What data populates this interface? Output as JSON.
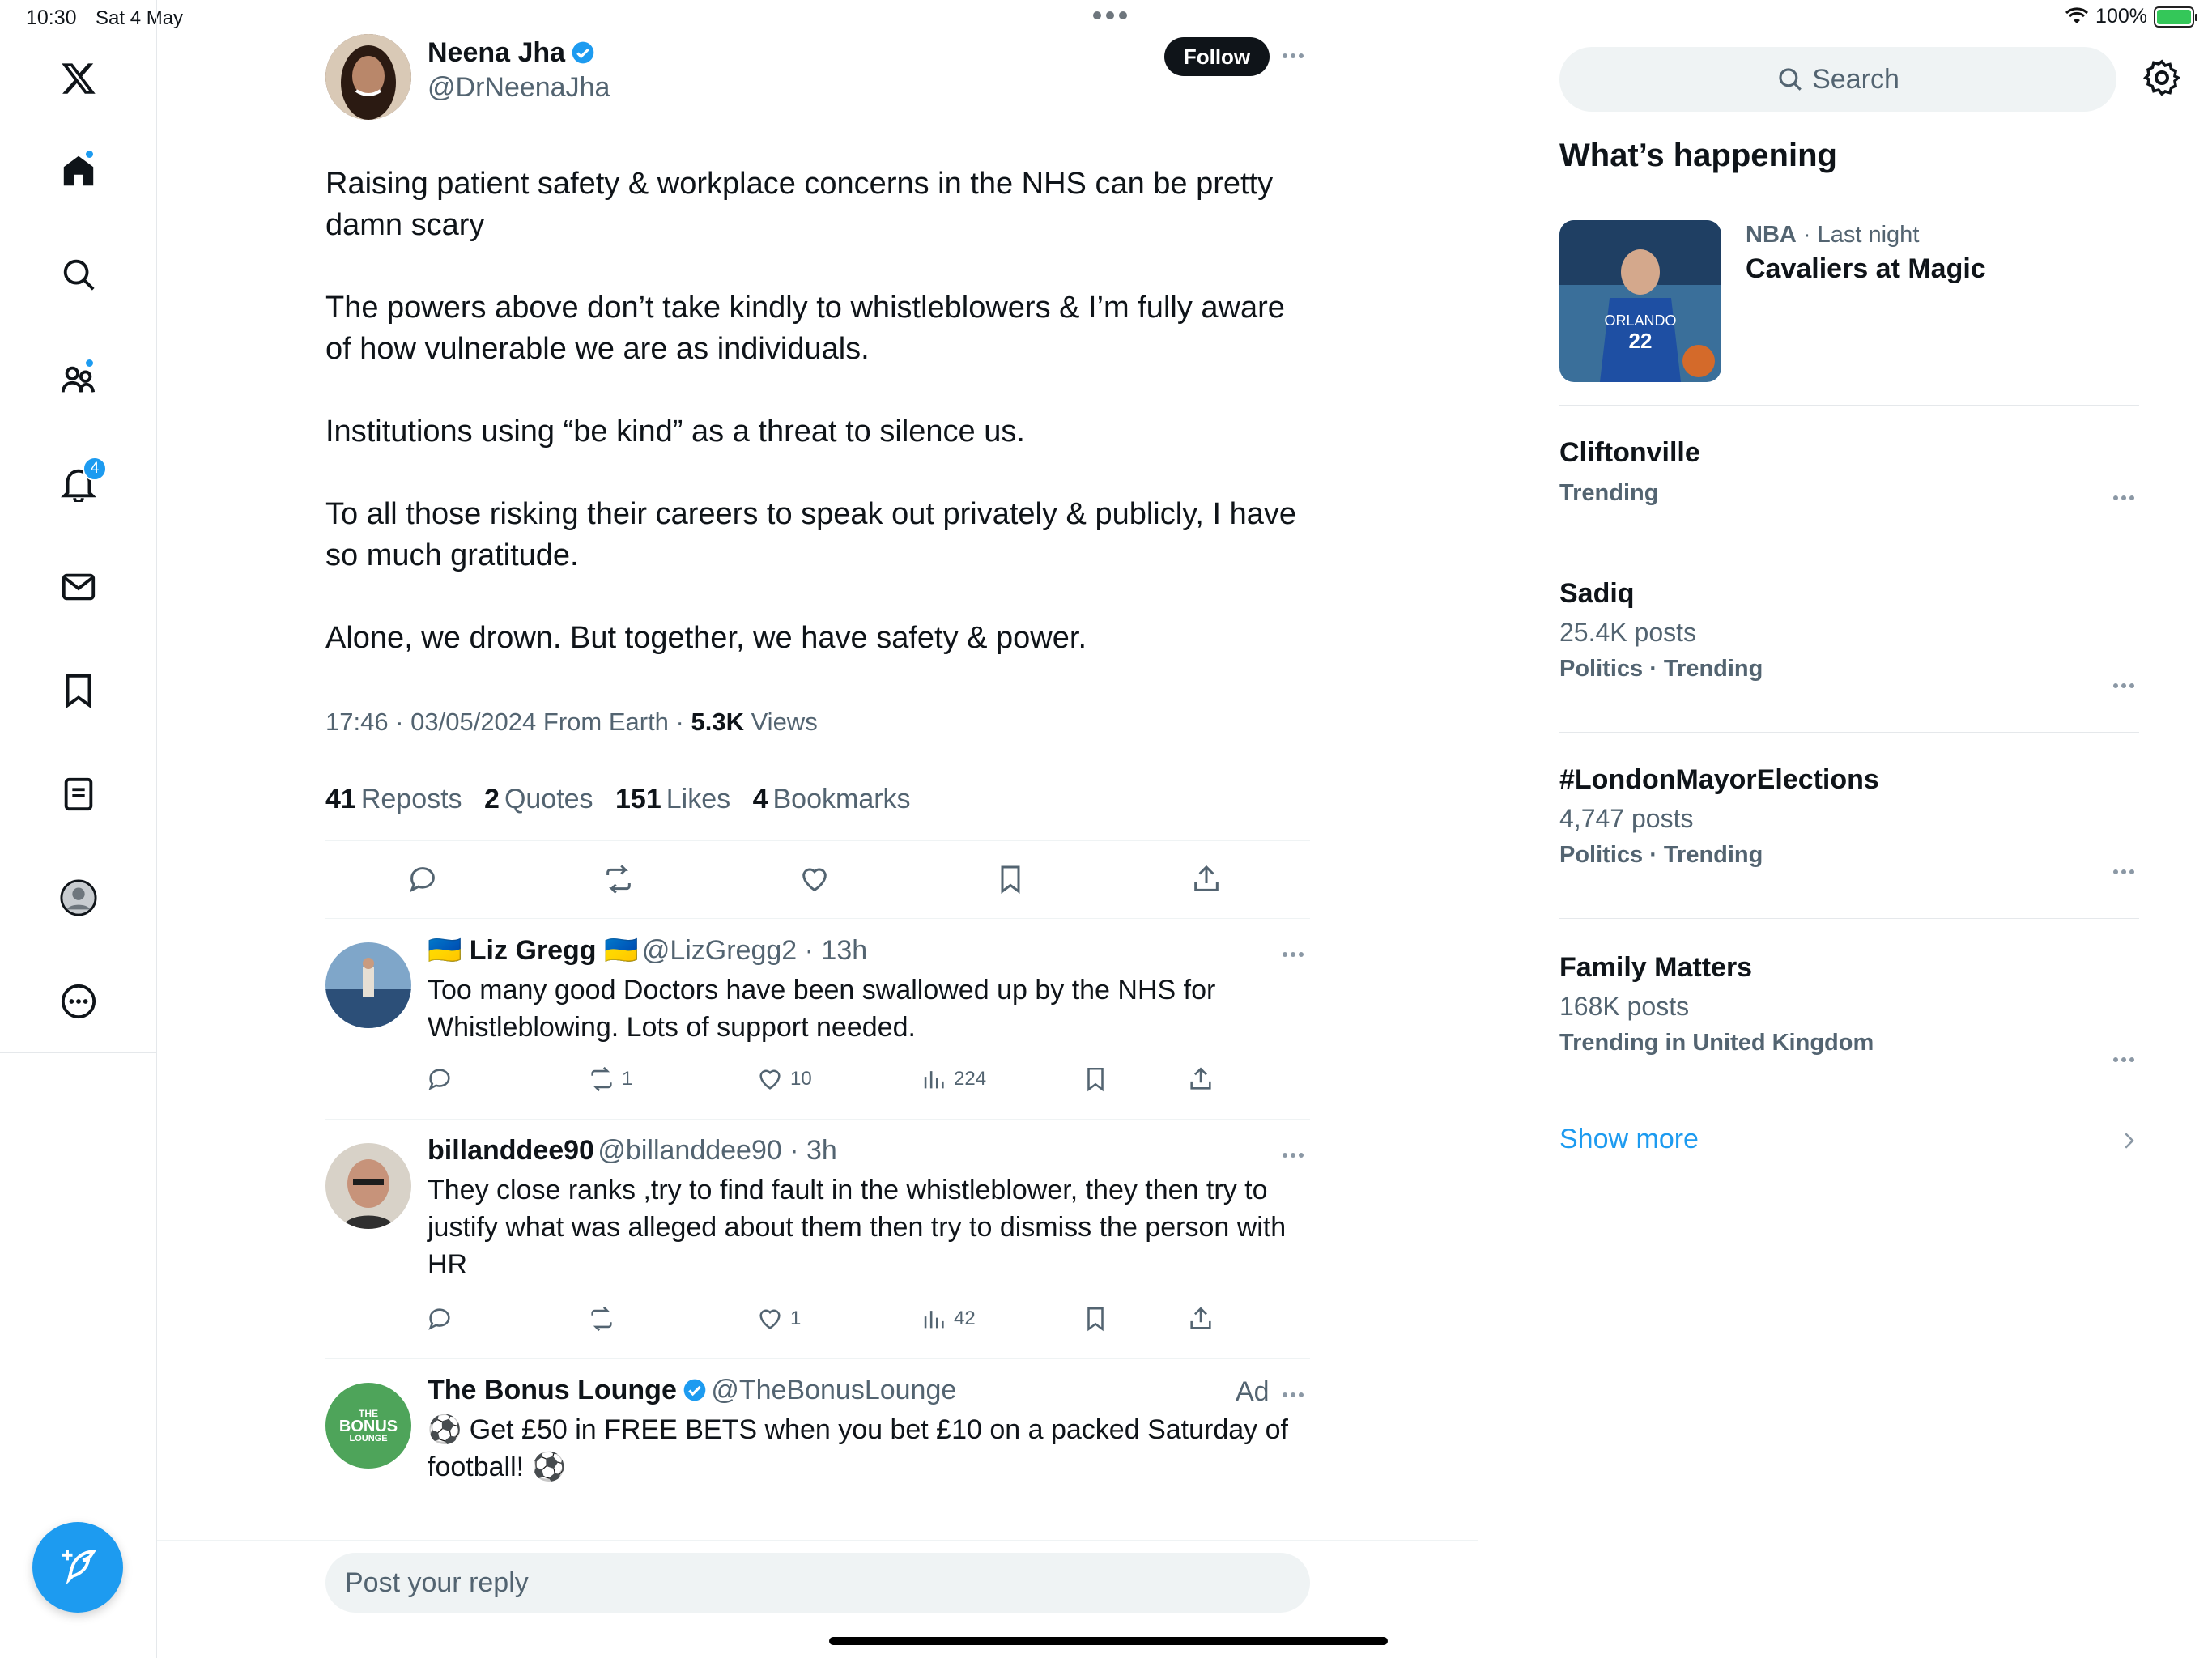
{
  "status_bar": {
    "time": "10:30",
    "date": "Sat 4 May",
    "battery": "100%"
  },
  "nav": {
    "notification_badge": "4"
  },
  "tweet": {
    "author_name": "Neena Jha",
    "author_handle": "@DrNeenaJha",
    "follow_label": "Follow",
    "paragraphs": [
      "Raising patient safety & workplace concerns in the NHS can be pretty damn scary",
      "The powers above don’t take kindly to whistleblowers & I’m fully aware of how vulnerable we are as individuals.",
      "Institutions using “be kind” as a threat to silence us.",
      "To all those risking their careers to speak out privately & publicly, I have so much gratitude.",
      "Alone, we drown. But together, we have safety & power."
    ],
    "meta": "17:46 · 03/05/2024 From Earth · ",
    "views_count": "5.3K",
    "views_label": " Views",
    "stats": {
      "reposts_count": "41",
      "reposts_label": "Reposts",
      "quotes_count": "2",
      "quotes_label": "Quotes",
      "likes_count": "151",
      "likes_label": "Likes",
      "bookmarks_count": "4",
      "bookmarks_label": "Bookmarks"
    }
  },
  "replies": [
    {
      "name": "🇺🇦 Liz Gregg 🇺🇦",
      "handle_time": "@LizGregg2 · 13h",
      "text": "Too many good Doctors have been swallowed up by the NHS for Whistleblowing.  Lots of support needed.",
      "reposts": "1",
      "likes": "10",
      "views": "224"
    },
    {
      "name": "billanddee90",
      "handle_time": "@billanddee90 · 3h",
      "text": "They close ranks ,try to find fault in the whistleblower, they then try to justify what was alleged about them then try to dismiss the person with HR",
      "reposts": "",
      "likes": "1",
      "views": "42"
    }
  ],
  "ad": {
    "name": "The Bonus Lounge",
    "handle": "@TheBonusLounge",
    "ad_label": "Ad",
    "text": "⚽ Get £50 in FREE BETS when you bet £10 on a packed Saturday of football! ⚽",
    "logo_text": [
      "THE",
      "BONUS",
      "LOUNGE"
    ]
  },
  "reply_box": {
    "placeholder": "Post your reply"
  },
  "sidebar": {
    "search_placeholder": "Search",
    "title": "What’s happening",
    "featured": {
      "category": "NBA",
      "time": " · Last night",
      "title": "Cavaliers at Magic",
      "jersey_text": "ORLANDO",
      "jersey_number": "22"
    },
    "trends": [
      {
        "title": "Cliftonville",
        "posts": "",
        "sub": "Trending"
      },
      {
        "title": "Sadiq",
        "posts": "25.4K posts",
        "sub": "Politics · Trending"
      },
      {
        "title": "#LondonMayorElections",
        "posts": "4,747 posts",
        "sub": "Politics · Trending"
      },
      {
        "title": "Family Matters",
        "posts": "168K posts",
        "sub": "Trending in United Kingdom"
      }
    ],
    "show_more": "Show more"
  },
  "colors": {
    "accent": "#1d9bf0",
    "text": "#0f1419",
    "muted": "#536471",
    "divider": "#eff3f4"
  }
}
